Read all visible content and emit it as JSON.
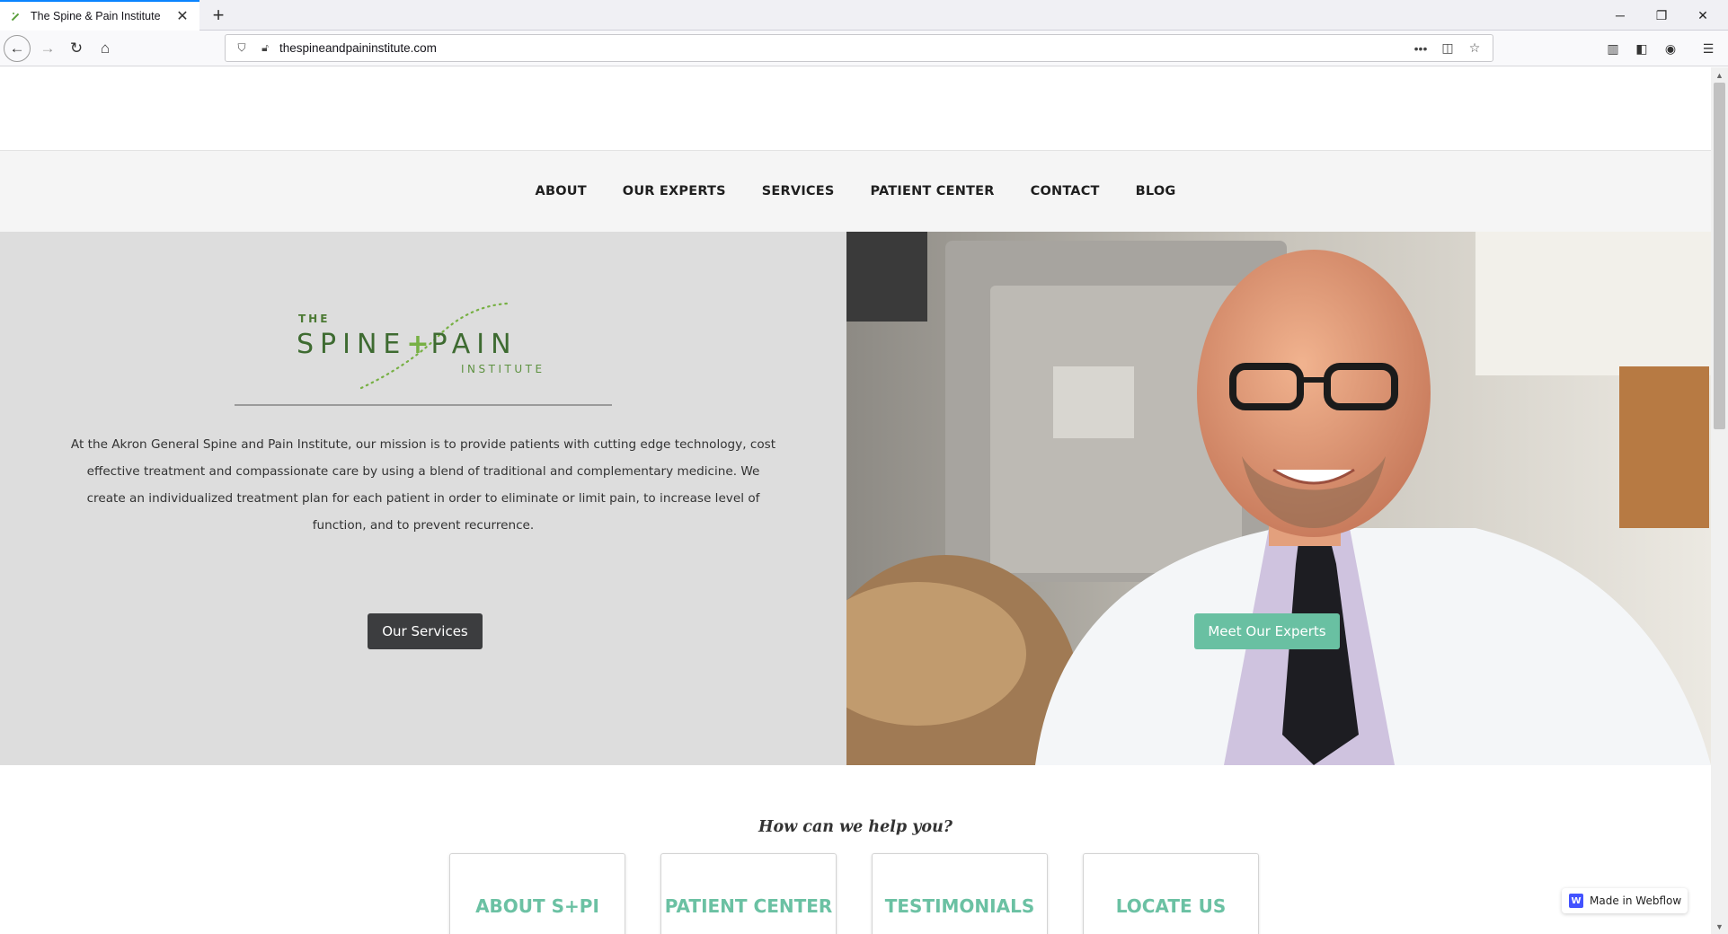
{
  "browser": {
    "tab_title": "The Spine & Pain Institute",
    "url": "thespineandpaininstitute.com"
  },
  "nav": {
    "items": [
      "ABOUT",
      "OUR EXPERTS",
      "SERVICES",
      "PATIENT CENTER",
      "CONTACT",
      "BLOG"
    ]
  },
  "logo": {
    "the": "THE",
    "spine": "SPINE",
    "plus": "+",
    "pain": "PAIN",
    "institute": "INSTITUTE"
  },
  "hero": {
    "mission": "At the Akron General Spine and Pain Institute, our mission is to provide patients with cutting edge technology, cost effective treatment and compassionate care by using a blend of traditional and complementary medicine. We create an individualized treatment plan for each patient in order to eliminate or limit pain, to increase level of function, and to prevent recurrence.",
    "services_button": "Our Services",
    "experts_button": "Meet Our Experts"
  },
  "help": {
    "heading": "How can we help you?",
    "cards": [
      "ABOUT S+PI",
      "PATIENT CENTER",
      "TESTIMONIALS",
      "LOCATE US"
    ]
  },
  "badge": {
    "label": "Made in Webflow"
  },
  "colors": {
    "accent": "#69c0a2",
    "dark_button": "#3c3d3f",
    "logo_green": "#3e6b31"
  }
}
